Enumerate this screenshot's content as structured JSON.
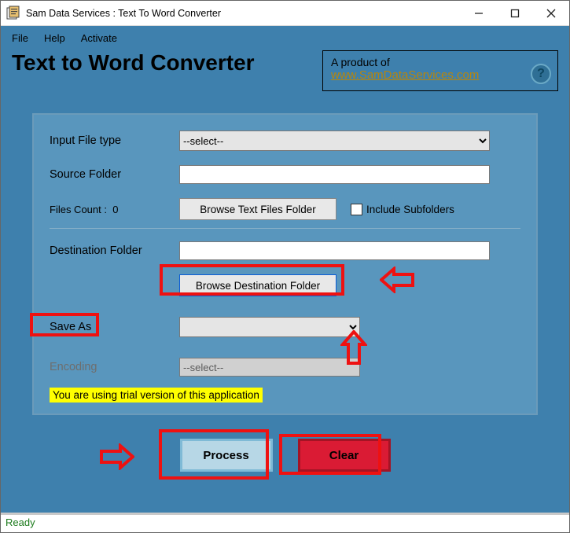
{
  "window": {
    "title": "Sam Data Services : Text To Word Converter"
  },
  "menu": {
    "file": "File",
    "help": "Help",
    "activate": "Activate"
  },
  "header": {
    "title": "Text to Word Converter",
    "product_of": "A product of",
    "product_link": "www.SamDataServices.com",
    "help_badge": "?"
  },
  "form": {
    "input_type_label": "Input File type",
    "input_type_value": "--select--",
    "source_label": "Source Folder",
    "source_value": "",
    "files_count_label": "Files Count :",
    "files_count_value": "0",
    "browse_src_btn": "Browse Text Files Folder",
    "include_sub_label": "Include Subfolders",
    "dest_label": "Destination Folder",
    "dest_value": "",
    "browse_dest_btn": "Browse Destination Folder",
    "saveas_label": "Save As",
    "saveas_value": "",
    "encoding_label": "Encoding",
    "encoding_value": "--select--",
    "trial_msg": "You are using trial version of this application"
  },
  "actions": {
    "process": "Process",
    "clear": "Clear"
  },
  "status": {
    "text": "Ready"
  }
}
